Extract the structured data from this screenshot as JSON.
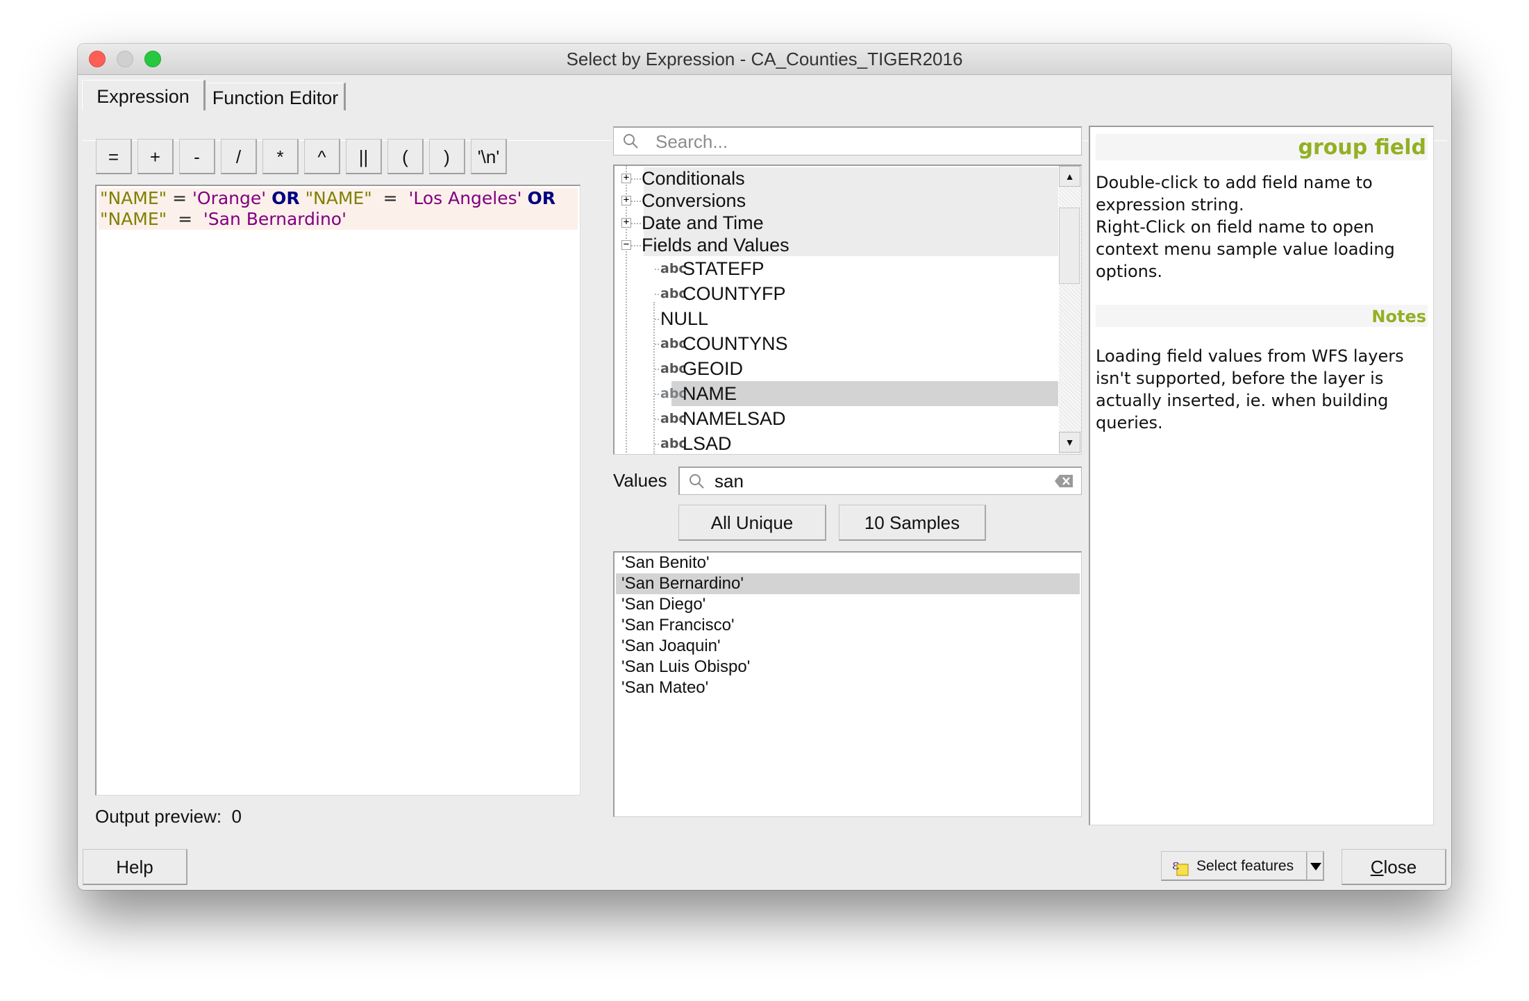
{
  "window": {
    "title": "Select by Expression - CA_Counties_TIGER2016"
  },
  "tabs": [
    {
      "label": "Expression",
      "active": true
    },
    {
      "label": "Function Editor",
      "active": false
    }
  ],
  "operators": [
    "=",
    "+",
    "-",
    "/",
    "*",
    "^",
    "||",
    "(",
    ")",
    "'\\n'"
  ],
  "editor": {
    "expression": "\"NAME\" = 'Orange' OR \"NAME\"  =  'Los Angeles' OR \"NAME\"  =  'San Bernardino'",
    "tokens": [
      {
        "t": "\"NAME\"",
        "k": "field"
      },
      {
        "t": " = ",
        "k": "op"
      },
      {
        "t": "'Orange'",
        "k": "str"
      },
      {
        "t": " ",
        "k": "op"
      },
      {
        "t": "OR",
        "k": "kw"
      },
      {
        "t": " ",
        "k": "op"
      },
      {
        "t": "\"NAME\"",
        "k": "field"
      },
      {
        "t": "  =  ",
        "k": "op"
      },
      {
        "t": "'Los Angeles'",
        "k": "str"
      },
      {
        "t": " ",
        "k": "op"
      },
      {
        "t": "OR",
        "k": "kw"
      },
      {
        "t": "\n",
        "k": "br"
      },
      {
        "t": "\"NAME\"",
        "k": "field"
      },
      {
        "t": "  =  ",
        "k": "op"
      },
      {
        "t": "'San Bernardino'",
        "k": "str"
      }
    ],
    "colors": {
      "field": "#808000",
      "string": "#800080",
      "keyword": "#000080"
    }
  },
  "output_preview": {
    "label": "Output preview:",
    "value": "0"
  },
  "function_search": {
    "placeholder": "Search..."
  },
  "tree": {
    "groups": [
      {
        "label": "Conditionals",
        "expanded": false
      },
      {
        "label": "Conversions",
        "expanded": false
      },
      {
        "label": "Date and Time",
        "expanded": false
      },
      {
        "label": "Fields and Values",
        "expanded": true
      }
    ],
    "fields": [
      {
        "label": "STATEFP",
        "icon": "abc",
        "selected": false
      },
      {
        "label": "COUNTYFP",
        "icon": "abc",
        "selected": false
      },
      {
        "label": "NULL",
        "icon": "",
        "selected": false
      },
      {
        "label": "COUNTYNS",
        "icon": "abc",
        "selected": false
      },
      {
        "label": "GEOID",
        "icon": "abc",
        "selected": false
      },
      {
        "label": "NAME",
        "icon": "abc",
        "selected": true
      },
      {
        "label": "NAMELSAD",
        "icon": "abc",
        "selected": false
      },
      {
        "label": "LSAD",
        "icon": "abc",
        "selected": false
      }
    ]
  },
  "values": {
    "label": "Values",
    "filter": "san",
    "all_unique_label": "All Unique",
    "samples_label": "10 Samples",
    "items": [
      {
        "label": "'San Benito'",
        "selected": false
      },
      {
        "label": "'San Bernardino'",
        "selected": true
      },
      {
        "label": "'San Diego'",
        "selected": false
      },
      {
        "label": "'San Francisco'",
        "selected": false
      },
      {
        "label": "'San Joaquin'",
        "selected": false
      },
      {
        "label": "'San Luis Obispo'",
        "selected": false
      },
      {
        "label": "'San Mateo'",
        "selected": false
      }
    ]
  },
  "help": {
    "heading": "group field",
    "body": "Double-click to add field name to expression string.\nRight-Click on field name to open context menu sample value loading options.",
    "notes_heading": "Notes",
    "notes_body": "Loading field values from WFS layers isn't supported, before the layer is actually inserted, ie. when building queries.",
    "accent_color": "#93b023"
  },
  "footer": {
    "help_label": "Help",
    "select_features_label": "Select features",
    "close_label": "Close",
    "close_mnemonic": "C",
    "close_rest": "lose"
  }
}
